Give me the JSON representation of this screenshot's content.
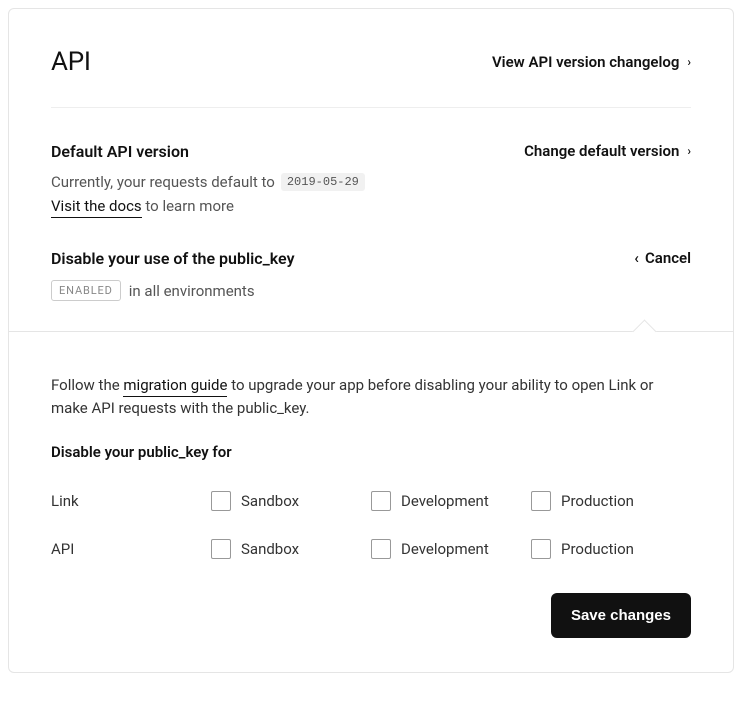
{
  "header": {
    "title": "API",
    "changelog_link": "View API version changelog"
  },
  "default_version": {
    "title": "Default API version",
    "change_link": "Change default version",
    "currently_prefix": "Currently, your requests default to",
    "version": "2019-05-29",
    "visit_docs": "Visit the docs",
    "learn_more_suffix": "to learn more"
  },
  "disable_public_key": {
    "title": "Disable your use of the public_key",
    "cancel": "Cancel",
    "status": "ENABLED",
    "status_suffix": "in all environments"
  },
  "panel": {
    "follow_prefix": "Follow the",
    "migration_guide": "migration guide",
    "follow_suffix": "to upgrade your app before disabling your ability to open Link or make API requests with the public_key.",
    "subtitle": "Disable your public_key for",
    "rows": [
      {
        "label": "Link"
      },
      {
        "label": "API"
      }
    ],
    "columns": [
      "Sandbox",
      "Development",
      "Production"
    ],
    "save_button": "Save changes"
  }
}
